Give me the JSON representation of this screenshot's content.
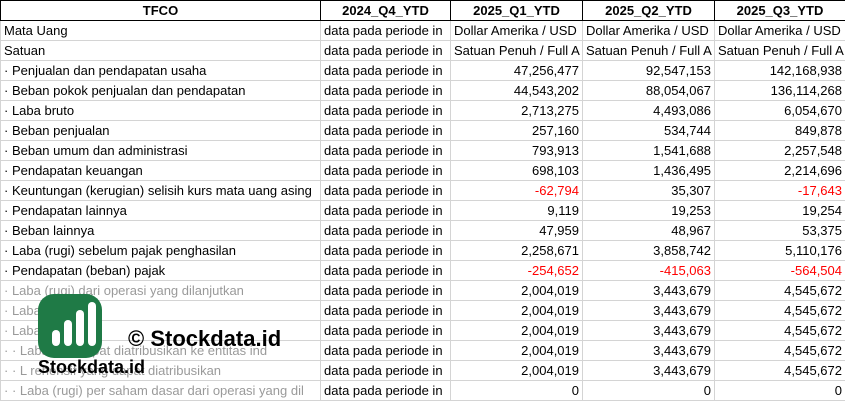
{
  "sheet": {
    "headers": [
      "TFCO",
      "2024_Q4_YTD",
      "2025_Q1_YTD",
      "2025_Q2_YTD",
      "2025_Q3_YTD"
    ],
    "rows": [
      {
        "label": "Mata Uang",
        "c1": "data pada periode in",
        "c2": "Dollar Amerika / USD",
        "c3": "Dollar Amerika / USD",
        "c4": "Dollar Amerika / USD"
      },
      {
        "label": "Satuan",
        "c1": "data pada periode in",
        "c2": "Satuan Penuh / Full A",
        "c3": "Satuan Penuh / Full A",
        "c4": "Satuan Penuh / Full A"
      },
      {
        "label": "· Penjualan dan pendapatan usaha",
        "c1": "data pada periode in",
        "c2": "47,256,477",
        "c3": "92,547,153",
        "c4": "142,168,938"
      },
      {
        "label": "· Beban pokok penjualan dan pendapatan",
        "c1": "data pada periode in",
        "c2": "44,543,202",
        "c3": "88,054,067",
        "c4": "136,114,268"
      },
      {
        "label": "· Laba bruto",
        "c1": "data pada periode in",
        "c2": "2,713,275",
        "c3": "4,493,086",
        "c4": "6,054,670"
      },
      {
        "label": "· Beban penjualan",
        "c1": "data pada periode in",
        "c2": "257,160",
        "c3": "534,744",
        "c4": "849,878"
      },
      {
        "label": "· Beban umum dan administrasi",
        "c1": "data pada periode in",
        "c2": "793,913",
        "c3": "1,541,688",
        "c4": "2,257,548"
      },
      {
        "label": "· Pendapatan keuangan",
        "c1": "data pada periode in",
        "c2": "698,103",
        "c3": "1,436,495",
        "c4": "2,214,696"
      },
      {
        "label": "· Keuntungan (kerugian) selisih kurs mata uang asing",
        "c1": "data pada periode in",
        "c2": "-62,794",
        "c3": "35,307",
        "c4": "-17,643"
      },
      {
        "label": "· Pendapatan lainnya",
        "c1": "data pada periode in",
        "c2": "9,119",
        "c3": "19,253",
        "c4": "19,254"
      },
      {
        "label": "· Beban lainnya",
        "c1": "data pada periode in",
        "c2": "47,959",
        "c3": "48,967",
        "c4": "53,375"
      },
      {
        "label": "· Laba (rugi) sebelum pajak penghasilan",
        "c1": "data pada periode in",
        "c2": "2,258,671",
        "c3": "3,858,742",
        "c4": "5,110,176"
      },
      {
        "label": "· Pendapatan (beban) pajak",
        "c1": "data pada periode in",
        "c2": "-254,652",
        "c3": "-415,063",
        "c4": "-564,504"
      },
      {
        "label": "· Laba (rugi) dari operasi yang dilanjutkan",
        "c1": "data pada periode in",
        "c2": "2,004,019",
        "c3": "3,443,679",
        "c4": "4,545,672"
      },
      {
        "label": "· Laba",
        "c1": "data pada periode in",
        "c2": "2,004,019",
        "c3": "3,443,679",
        "c4": "4,545,672"
      },
      {
        "label": "· Laba                    rehensif",
        "c1": "data pada periode in",
        "c2": "2,004,019",
        "c3": "3,443,679",
        "c4": "4,545,672"
      },
      {
        "label": "· · Laba           ang dapat diatribusikan ke entitas ind",
        "c1": "data pada periode in",
        "c2": "2,004,019",
        "c3": "3,443,679",
        "c4": "4,545,672"
      },
      {
        "label": "· · L           rehensif yang dapat diatribusikan",
        "c1": "data pada periode in",
        "c2": "2,004,019",
        "c3": "3,443,679",
        "c4": "4,545,672"
      },
      {
        "label": "· · Laba (rugi) per saham dasar dari operasi yang dil",
        "c1": "data pada periode in",
        "c2": "0",
        "c3": "0",
        "c4": "0"
      }
    ]
  },
  "watermark": {
    "copyright": "© Stockdata.id",
    "brand": "Stockdata.id"
  },
  "colors": {
    "negative": "#ff0000",
    "logo": "#1f7a46"
  }
}
